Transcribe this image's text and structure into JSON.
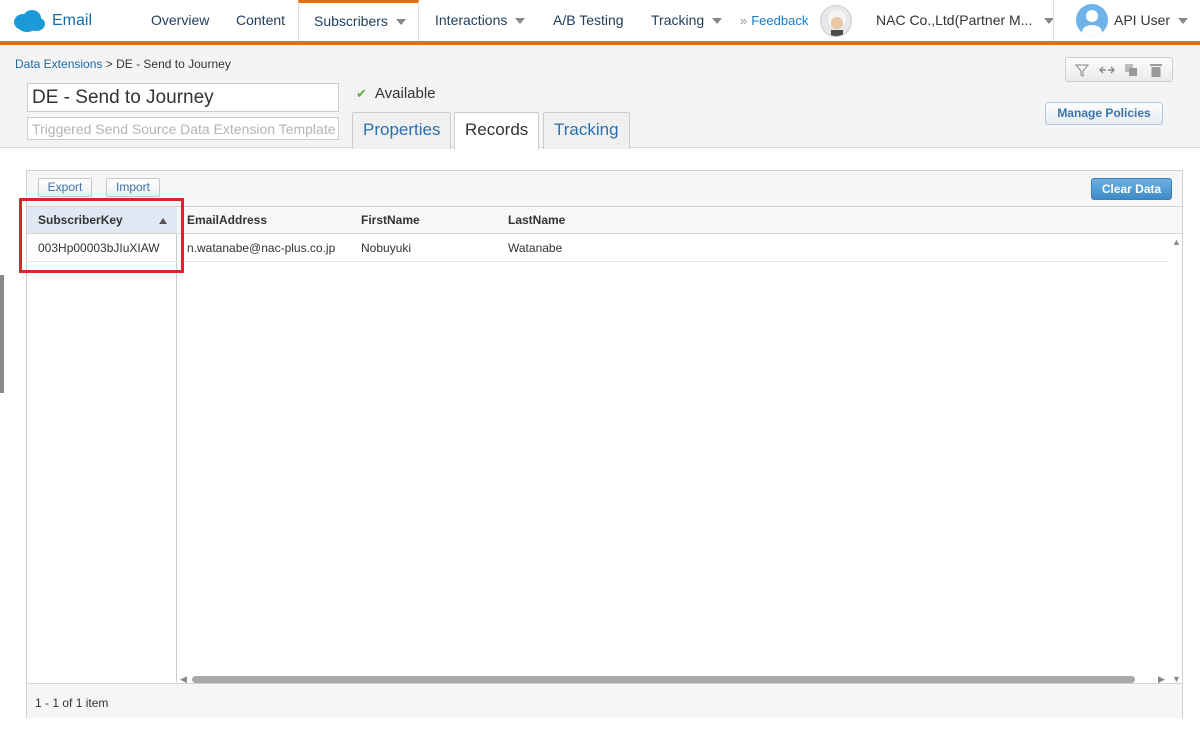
{
  "app": {
    "name": "Email"
  },
  "nav": {
    "items": [
      {
        "label": "Overview"
      },
      {
        "label": "Content"
      },
      {
        "label": "Subscribers"
      },
      {
        "label": "Interactions"
      },
      {
        "label": "A/B Testing"
      },
      {
        "label": "Tracking"
      }
    ],
    "feedback": "Feedback",
    "account": "NAC Co.,Ltd(Partner M...",
    "user": "API User"
  },
  "breadcrumb": {
    "parent": "Data Extensions",
    "separator": ">",
    "current": "DE - Send to Journey"
  },
  "data_extension": {
    "name": "DE - Send to Journey",
    "description_placeholder": "Triggered Send Source Data Extension Template",
    "status": "Available"
  },
  "tabs": [
    {
      "label": "Properties"
    },
    {
      "label": "Records"
    },
    {
      "label": "Tracking"
    }
  ],
  "actions": {
    "manage_policies": "Manage Policies",
    "export": "Export",
    "import": "Import",
    "clear_data": "Clear Data"
  },
  "grid": {
    "columns": [
      "SubscriberKey",
      "EmailAddress",
      "FirstName",
      "LastName"
    ],
    "rows": [
      [
        "003Hp00003bJIuXIAW",
        "n.watanabe@nac-plus.co.jp",
        "Nobuyuki",
        "Watanabe"
      ]
    ],
    "pager": "1 - 1 of 1 item"
  },
  "colors": {
    "accent": "#e8700c",
    "link": "#1a6aa8",
    "highlight": "#d8262e",
    "primary_button": "#3c8ac8"
  }
}
